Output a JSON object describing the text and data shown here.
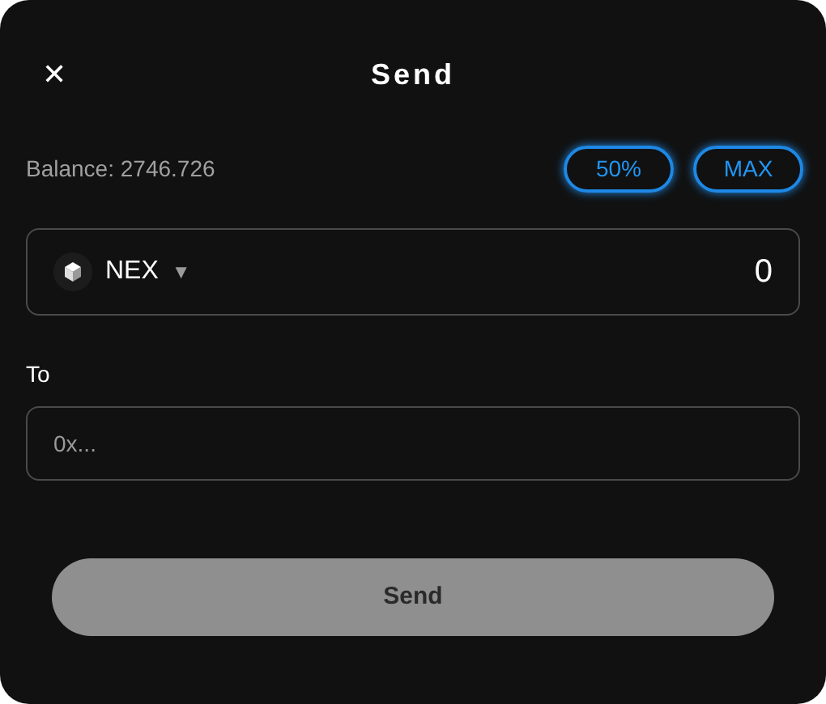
{
  "header": {
    "close": "✕",
    "title": "Send"
  },
  "balance": "Balance: 2746.726",
  "quick_amounts": [
    "50%",
    "MAX"
  ],
  "amount": {
    "token": "NEX",
    "caret": "▼",
    "value": "0"
  },
  "recipient": {
    "label": "To",
    "placeholder": "0x..."
  },
  "send_button": {
    "label": "Send",
    "disabled": true
  }
}
